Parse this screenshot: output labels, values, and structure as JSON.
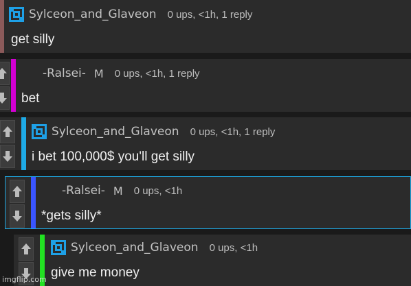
{
  "comments": [
    {
      "username": "Sylceon_and_Glaveon",
      "meta": "0 ups, <1h, 1 reply",
      "text": "get silly",
      "stripe_color": "#8b5a5a",
      "avatar": "blue-pixel-avatar-icon"
    },
    {
      "username": "-Ralsei-",
      "mod_badge": "M",
      "meta": "0 ups, <1h, 1 reply",
      "text": "bet",
      "stripe_color": "#d400d4"
    },
    {
      "username": "Sylceon_and_Glaveon",
      "meta": "0 ups, <1h, 1 reply",
      "text": "i bet 100,000$ you'll get silly",
      "stripe_color": "#1eaae6",
      "avatar": "blue-pixel-avatar-icon"
    },
    {
      "username": "-Ralsei-",
      "mod_badge": "M",
      "meta": "0 ups, <1h",
      "text": "*gets silly*",
      "stripe_color": "#3a55ff"
    },
    {
      "username": "Sylceon_and_Glaveon",
      "meta": "0 ups, <1h",
      "text": "give me money",
      "stripe_color": "#22e222",
      "avatar": "blue-pixel-avatar-icon"
    }
  ],
  "watermark": "imgflip.com",
  "colors": {
    "background": "#1a1a1a",
    "comment_bg": "#2b2b2b",
    "avatar_blue": "#1ea0e6"
  }
}
